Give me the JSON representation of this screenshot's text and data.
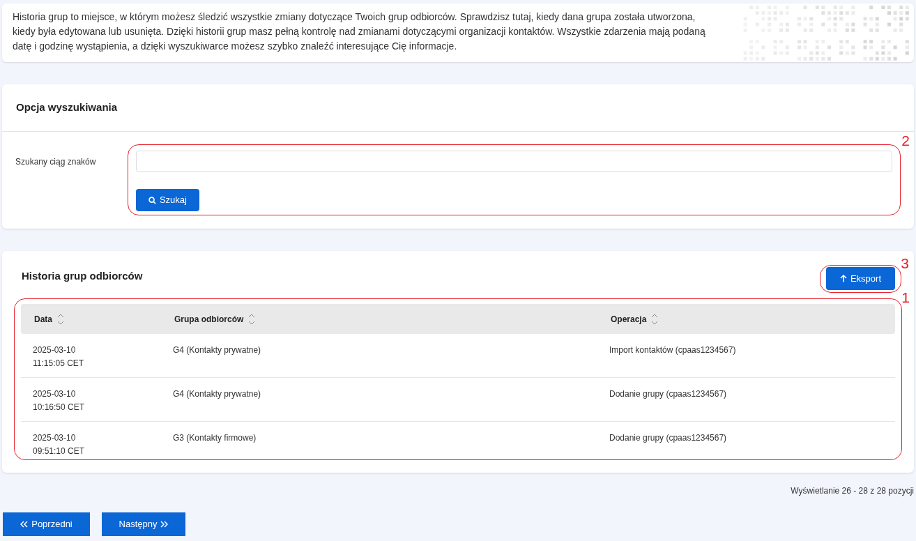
{
  "intro": {
    "text": "Historia grup to miejsce, w którym możesz śledzić wszystkie zmiany dotyczące Twoich grup odbiorców. Sprawdzisz tutaj, kiedy dana grupa została utworzona, kiedy była edytowana lub usunięta. Dzięki historii grup masz pełną kontrolę nad zmianami dotyczącymi organizacji kontaktów. Wszystkie zdarzenia mają podaną datę i godzinę wystąpienia, a dzięki wyszukiwarce możesz szybko znaleźć interesujące Cię informacje."
  },
  "search": {
    "title": "Opcja wyszukiwania",
    "label": "Szukany ciąg znaków",
    "button": "Szukaj",
    "annotation": "2"
  },
  "history": {
    "title": "Historia grup odbiorców",
    "export_button": "Eksport",
    "export_annotation": "3",
    "table_annotation": "1",
    "columns": [
      "Data",
      "Grupa odbiorców",
      "Operacja"
    ],
    "rows": [
      {
        "date": "2025-03-10",
        "time": "11:15:05 CET",
        "group": "G4 (Kontakty prywatne)",
        "operation": "Import kontaktów (cpaas1234567)"
      },
      {
        "date": "2025-03-10",
        "time": "10:16:50 CET",
        "group": "G4 (Kontakty prywatne)",
        "operation": "Dodanie grupy (cpaas1234567)"
      },
      {
        "date": "2025-03-10",
        "time": "09:51:10 CET",
        "group": "G3 (Kontakty firmowe)",
        "operation": "Dodanie grupy (cpaas1234567)"
      }
    ]
  },
  "pagination": {
    "info": "Wyświetlanie 26 - 28 z 28 pozycji",
    "previous": "Poprzedni",
    "next": "Następny"
  }
}
